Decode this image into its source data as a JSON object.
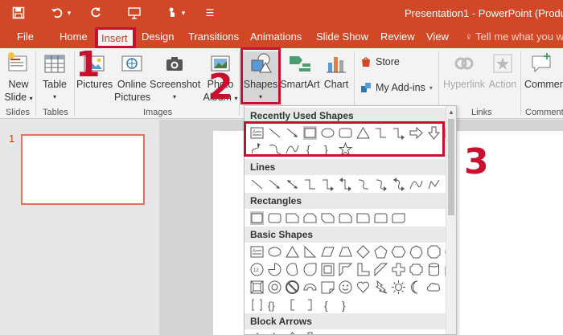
{
  "window": {
    "title": "Presentation1 - PowerPoint (Produ"
  },
  "tabs": [
    {
      "label": "File"
    },
    {
      "label": "Home"
    },
    {
      "label": "Insert"
    },
    {
      "label": "Design"
    },
    {
      "label": "Transitions"
    },
    {
      "label": "Animations"
    },
    {
      "label": "Slide Show"
    },
    {
      "label": "Review"
    },
    {
      "label": "View"
    }
  ],
  "tell_me": "Tell me what you wa",
  "ribbon": {
    "new_slide": {
      "line1": "New",
      "line2": "Slide"
    },
    "table": {
      "label": "Table"
    },
    "pictures": {
      "label": "Pictures"
    },
    "online_pictures": {
      "line1": "Online",
      "line2": "Pictures"
    },
    "screenshot": {
      "label": "Screenshot"
    },
    "photo_album": {
      "line1": "Photo",
      "line2": "Album"
    },
    "shapes": {
      "label": "Shapes"
    },
    "smartart": {
      "label": "SmartArt"
    },
    "chart": {
      "label": "Chart"
    },
    "store": {
      "label": "Store"
    },
    "my_addins": {
      "label": "My Add-ins"
    },
    "hyperlink": {
      "label": "Hyperlink"
    },
    "action": {
      "label": "Action"
    },
    "comment": {
      "label": "Comment"
    },
    "groups": {
      "slides": "Slides",
      "tables": "Tables",
      "images": "Images",
      "links": "Links",
      "comments": "Comment"
    }
  },
  "annotations": {
    "step1": "1",
    "step2": "2",
    "step3": "3"
  },
  "thumbnail": {
    "number": "1"
  },
  "gallery": {
    "recent": "Recently Used Shapes",
    "lines": "Lines",
    "rectangles": "Rectangles",
    "basic": "Basic Shapes",
    "block_arrows": "Block Arrows"
  },
  "colors": {
    "accent": "#d24726",
    "annotation": "#c8102e"
  }
}
